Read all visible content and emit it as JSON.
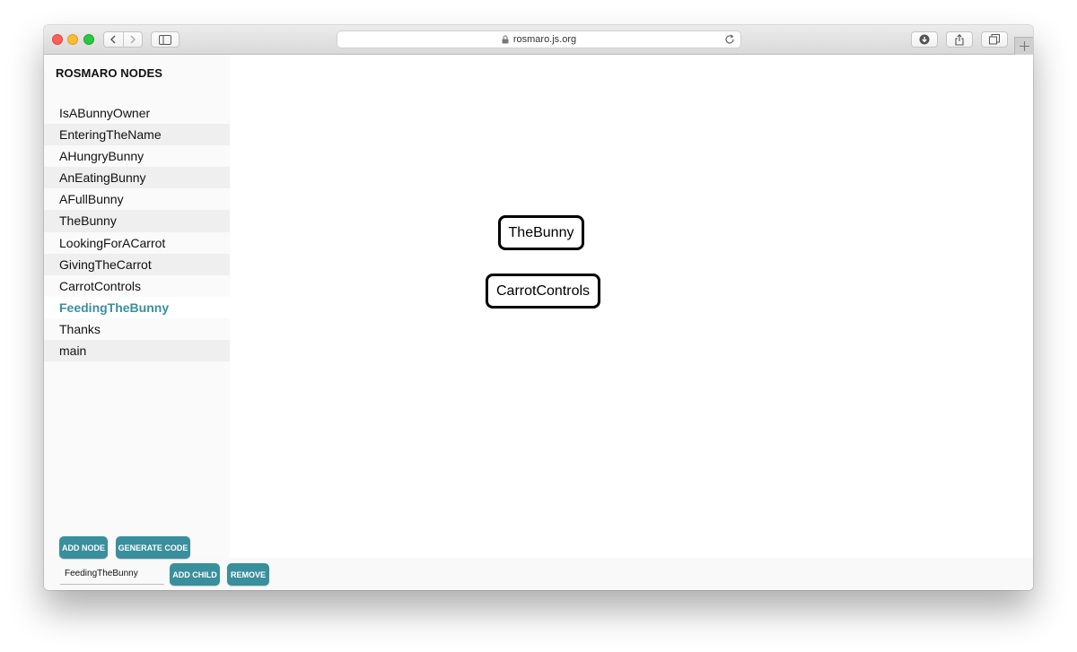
{
  "browser": {
    "url": "rosmaro.js.org"
  },
  "sidebar": {
    "title": "ROSMARO NODES",
    "nodes": [
      {
        "label": "IsABunnyOwner"
      },
      {
        "label": "EnteringTheName"
      },
      {
        "label": "AHungryBunny"
      },
      {
        "label": "AnEatingBunny"
      },
      {
        "label": "AFullBunny"
      },
      {
        "label": "TheBunny"
      },
      {
        "label": "LookingForACarrot"
      },
      {
        "label": "GivingTheCarrot"
      },
      {
        "label": "CarrotControls"
      },
      {
        "label": "FeedingTheBunny",
        "selected": true
      },
      {
        "label": "Thanks"
      },
      {
        "label": "main"
      }
    ],
    "add_node_label": "ADD NODE",
    "generate_code_label": "GENERATE CODE"
  },
  "toolbar": {
    "node_name_value": "FeedingTheBunny",
    "add_child_label": "ADD CHILD",
    "remove_label": "REMOVE"
  },
  "canvas": {
    "nodes": [
      {
        "label": "TheBunny"
      },
      {
        "label": "CarrotControls"
      }
    ]
  },
  "colors": {
    "accent": "#3a8f9c",
    "selected_text": "#3a8f9c"
  },
  "icons": {
    "back": "chevron-left-icon",
    "forward": "chevron-right-icon",
    "sidebar": "sidebar-icon",
    "lock": "lock-icon",
    "reload": "reload-icon",
    "download": "download-icon",
    "share": "share-icon",
    "tabs": "tabs-icon",
    "new_tab": "plus-icon"
  }
}
